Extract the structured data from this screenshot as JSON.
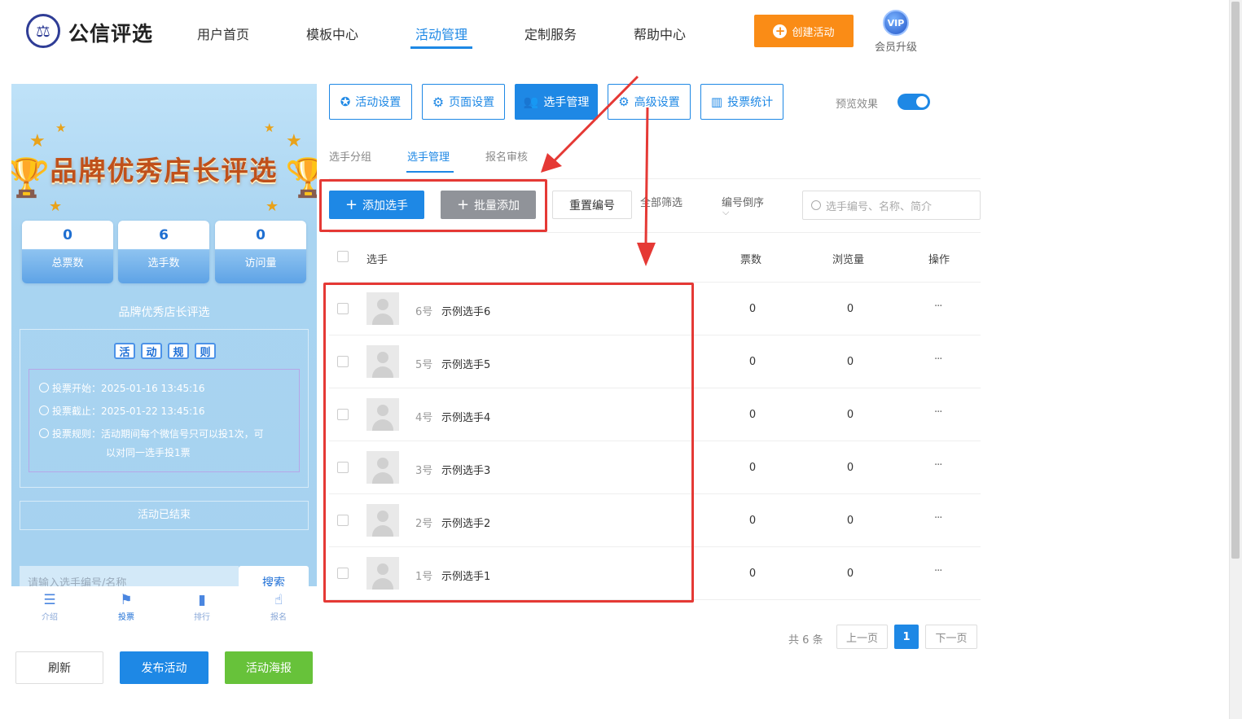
{
  "header": {
    "brand": "公信评选",
    "nav": [
      "用户首页",
      "模板中心",
      "活动管理",
      "定制服务",
      "帮助中心"
    ],
    "active_nav": "活动管理",
    "create_label": "创建活动",
    "vip_badge": "VIP",
    "vip_label": "会员升级"
  },
  "preview": {
    "banner_title": "品牌优秀店长评选",
    "stats": [
      {
        "value": "0",
        "label": "总票数"
      },
      {
        "value": "6",
        "label": "选手数"
      },
      {
        "value": "0",
        "label": "访问量"
      }
    ],
    "subtitle": "品牌优秀店长评选",
    "rules_chars": [
      "活",
      "动",
      "规",
      "则"
    ],
    "rules": [
      "投票开始：2025-01-16 13:45:16",
      "投票截止：2025-01-22 13:45:16",
      "投票规则：活动期间每个微信号只可以投1次，可",
      "以对同一选手投1票"
    ],
    "ended": "活动已结束",
    "search_placeholder": "请输入选手编号/名称",
    "search_button": "搜索",
    "tabbar": [
      "介绍",
      "投票",
      "排行",
      "报名"
    ],
    "active_tab": "投票"
  },
  "left_buttons": {
    "refresh": "刷新",
    "publish": "发布活动",
    "poster": "活动海报"
  },
  "tabs": [
    "活动设置",
    "页面设置",
    "选手管理",
    "高级设置",
    "投票统计"
  ],
  "active_tab": "选手管理",
  "preview_toggle": {
    "label": "预览效果",
    "on": true
  },
  "subtabs": [
    "选手分组",
    "选手管理",
    "报名审核"
  ],
  "active_subtab": "选手管理",
  "actions": {
    "add": "添加选手",
    "batch_add": "批量添加",
    "reset": "重置编号",
    "filter_all": "全部筛选",
    "sort": "编号倒序",
    "search_placeholder": "选手编号、名称、简介"
  },
  "table": {
    "columns": [
      "选手",
      "票数",
      "浏览量",
      "操作"
    ],
    "rows": [
      {
        "num": "6号",
        "name": "示例选手6",
        "votes": "0",
        "views": "0",
        "op": "···"
      },
      {
        "num": "5号",
        "name": "示例选手5",
        "votes": "0",
        "views": "0",
        "op": "···"
      },
      {
        "num": "4号",
        "name": "示例选手4",
        "votes": "0",
        "views": "0",
        "op": "···"
      },
      {
        "num": "3号",
        "name": "示例选手3",
        "votes": "0",
        "views": "0",
        "op": "···"
      },
      {
        "num": "2号",
        "name": "示例选手2",
        "votes": "0",
        "views": "0",
        "op": "···"
      },
      {
        "num": "1号",
        "name": "示例选手1",
        "votes": "0",
        "views": "0",
        "op": "···"
      }
    ]
  },
  "pager": {
    "total": "共 6 条",
    "prev": "上一页",
    "current": "1",
    "next": "下一页"
  },
  "colors": {
    "primary": "#1e88e5",
    "orange": "#fa8c16",
    "green": "#67c23a",
    "annotation": "#e53935"
  }
}
